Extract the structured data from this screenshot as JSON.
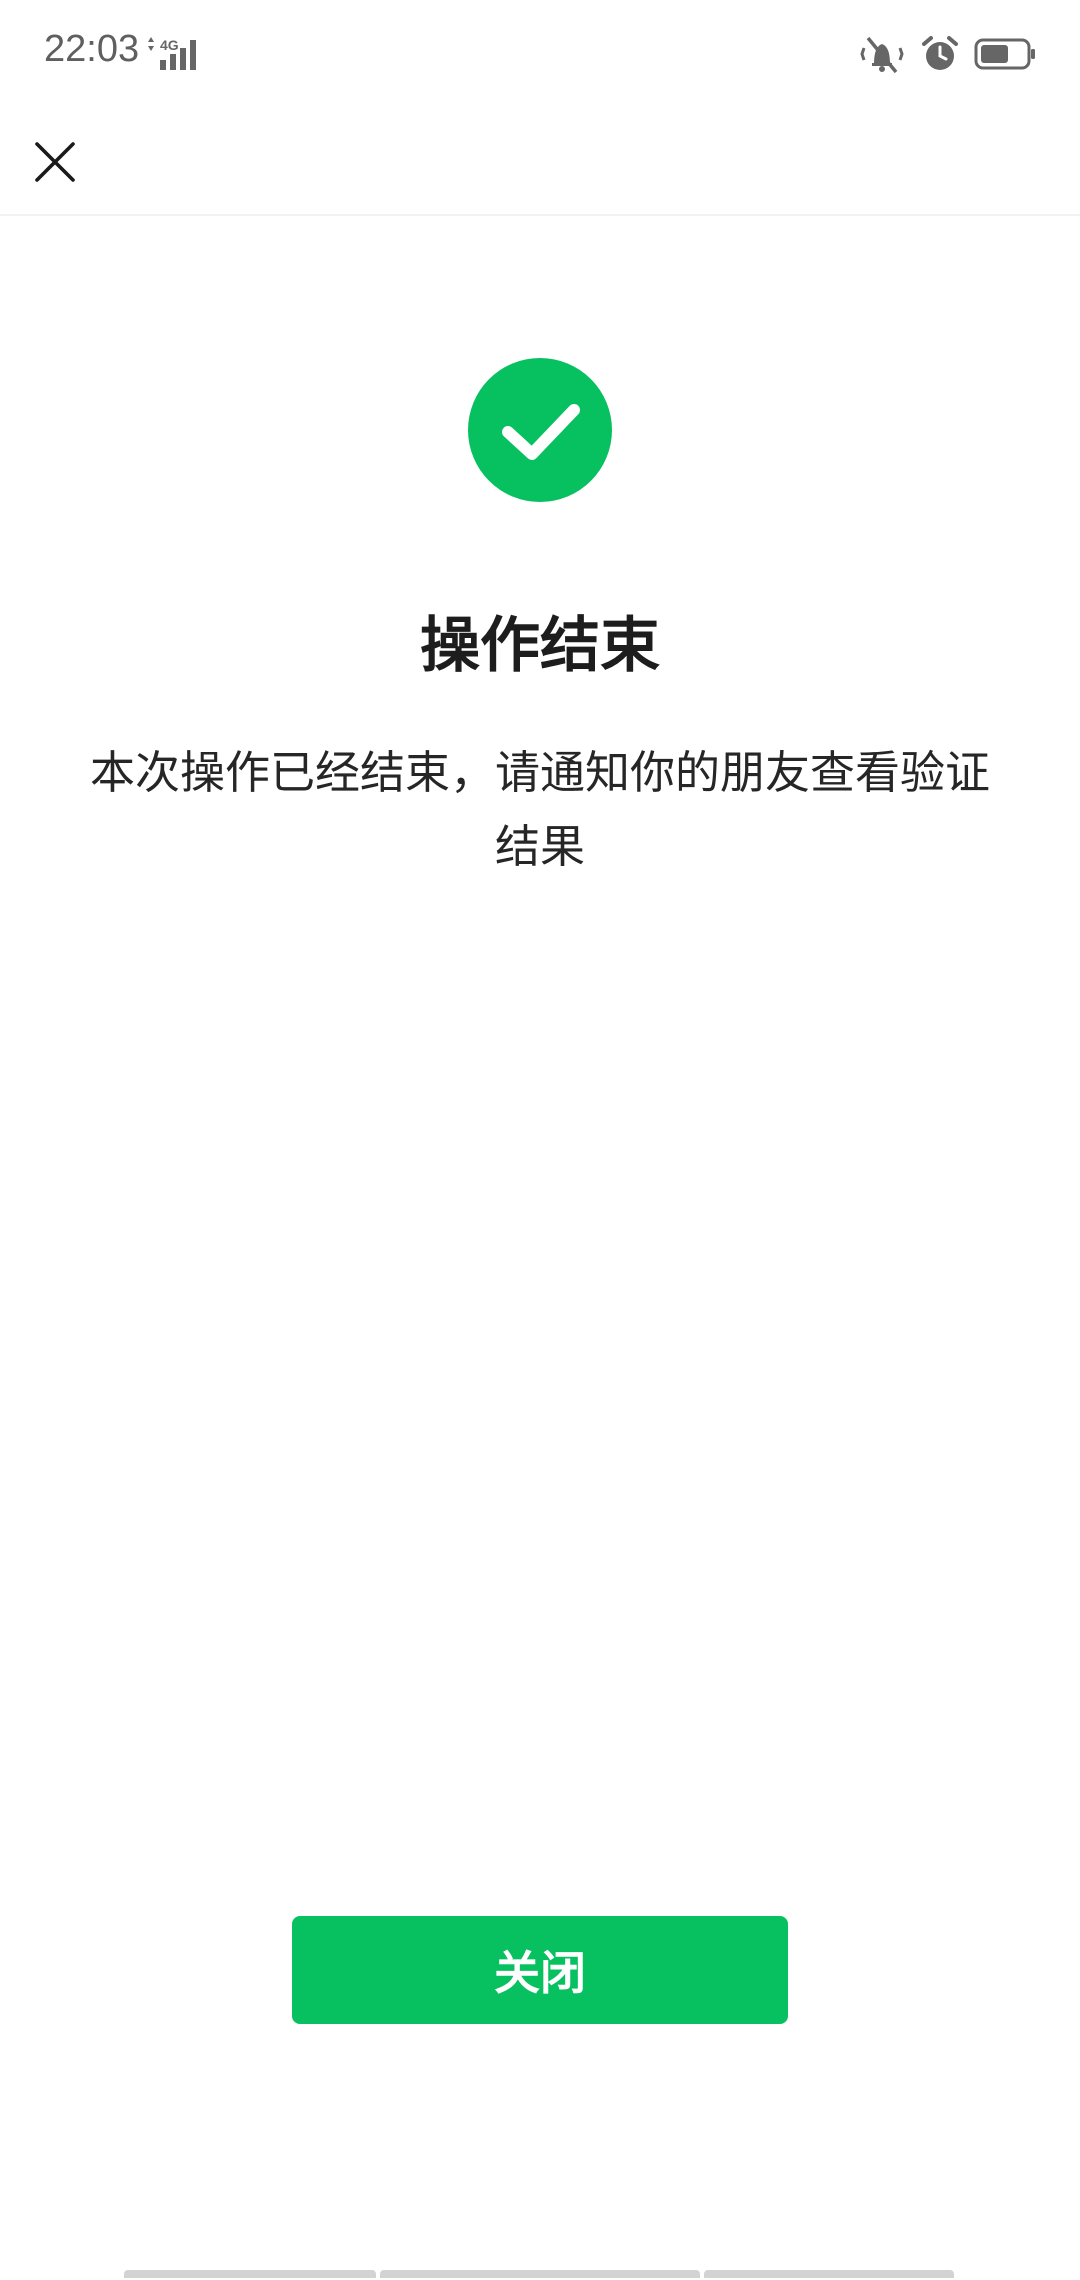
{
  "status_bar": {
    "time": "22:03",
    "network": "4G",
    "icons": [
      "vibrate-silent-icon",
      "alarm-icon",
      "battery-icon"
    ]
  },
  "top_bar": {
    "close_icon": "close-icon"
  },
  "result": {
    "title": "操作结束",
    "description": "本次操作已经结束，请通知你的朋友查看验证结果"
  },
  "actions": {
    "close_label": "关闭"
  },
  "colors": {
    "accent": "#07c160",
    "title_text": "#1d1d1d",
    "body_text": "#262626",
    "status_text": "#5f5f5f"
  }
}
